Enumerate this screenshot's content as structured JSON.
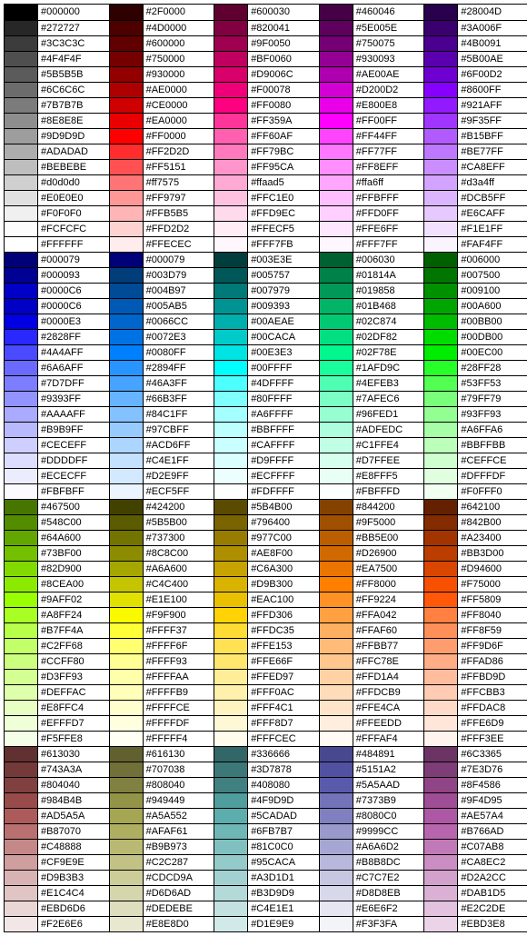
{
  "chart_data": {
    "type": "table",
    "title": "",
    "columns": 5,
    "rows": 53,
    "cells": [
      [
        "#000000",
        "#2F0000",
        "#600030",
        "#460046",
        "#28004D"
      ],
      [
        "#272727",
        "#4D0000",
        "#820041",
        "#5E005E",
        "#3A006F"
      ],
      [
        "#3C3C3C",
        "#600000",
        "#9F0050",
        "#750075",
        "#4B0091"
      ],
      [
        "#4F4F4F",
        "#750000",
        "#BF0060",
        "#930093",
        "#5B00AE"
      ],
      [
        "#5B5B5B",
        "#930000",
        "#D9006C",
        "#AE00AE",
        "#6F00D2"
      ],
      [
        "#6C6C6C",
        "#AE0000",
        "#F00078",
        "#D200D2",
        "#8600FF"
      ],
      [
        "#7B7B7B",
        "#CE0000",
        "#FF0080",
        "#E800E8",
        "#921AFF"
      ],
      [
        "#8E8E8E",
        "#EA0000",
        "#FF359A",
        "#FF00FF",
        "#9F35FF"
      ],
      [
        "#9D9D9D",
        "#FF0000",
        "#FF60AF",
        "#FF44FF",
        "#B15BFF"
      ],
      [
        "#ADADAD",
        "#FF2D2D",
        "#FF79BC",
        "#FF77FF",
        "#BE77FF"
      ],
      [
        "#BEBEBE",
        "#FF5151",
        "#FF95CA",
        "#FF8EFF",
        "#CA8EFF"
      ],
      [
        "#d0d0d0",
        "#ff7575",
        "#ffaad5",
        "#ffa6ff",
        "#d3a4ff"
      ],
      [
        "#E0E0E0",
        "#FF9797",
        "#FFC1E0",
        "#FFBFFF",
        "#DCB5FF"
      ],
      [
        "#F0F0F0",
        "#FFB5B5",
        "#FFD9EC",
        "#FFD0FF",
        "#E6CAFF"
      ],
      [
        "#FCFCFC",
        "#FFD2D2",
        "#FFECF5",
        "#FFE6FF",
        "#F1E1FF"
      ],
      [
        "#FFFFFF",
        "#FFECEC",
        "#FFF7FB",
        "#FFF7FF",
        "#FAF4FF"
      ],
      [
        "#000079",
        "#000079",
        "#003E3E",
        "#006030",
        "#006000"
      ],
      [
        "#000093",
        "#003D79",
        "#005757",
        "#01814A",
        "#007500"
      ],
      [
        "#0000C6",
        "#004B97",
        "#007979",
        "#019858",
        "#009100"
      ],
      [
        "#0000C6",
        "#005AB5",
        "#009393",
        "#01B468",
        "#00A600"
      ],
      [
        "#0000E3",
        "#0066CC",
        "#00AEAE",
        "#02C874",
        "#00BB00"
      ],
      [
        "#2828FF",
        "#0072E3",
        "#00CACA",
        "#02DF82",
        "#00DB00"
      ],
      [
        "#4A4AFF",
        "#0080FF",
        "#00E3E3",
        "#02F78E",
        "#00EC00"
      ],
      [
        "#6A6AFF",
        "#2894FF",
        "#00FFFF",
        "#1AFD9C",
        "#28FF28"
      ],
      [
        "#7D7DFF",
        "#46A3FF",
        "#4DFFFF",
        "#4EFEB3",
        "#53FF53"
      ],
      [
        "#9393FF",
        "#66B3FF",
        "#80FFFF",
        "#7AFEC6",
        "#79FF79"
      ],
      [
        "#AAAAFF",
        "#84C1FF",
        "#A6FFFF",
        "#96FED1",
        "#93FF93"
      ],
      [
        "#B9B9FF",
        "#97CBFF",
        "#BBFFFF",
        "#ADFEDC",
        "#A6FFA6"
      ],
      [
        "#CECEFF",
        "#ACD6FF",
        "#CAFFFF",
        "#C1FFE4",
        "#BBFFBB"
      ],
      [
        "#DDDDFF",
        "#C4E1FF",
        "#D9FFFF",
        "#D7FFEE",
        "#CEFFCE"
      ],
      [
        "#ECECFF",
        "#D2E9FF",
        "#ECFFFF",
        "#E8FFF5",
        "#DFFFDF"
      ],
      [
        "#FBFBFF",
        "#ECF5FF",
        "#FDFFFF",
        "#FBFFFD",
        "#F0FFF0"
      ],
      [
        "#467500",
        "#424200",
        "#5B4B00",
        "#844200",
        "#642100"
      ],
      [
        "#548C00",
        "#5B5B00",
        "#796400",
        "#9F5000",
        "#842B00"
      ],
      [
        "#64A600",
        "#737300",
        "#977C00",
        "#BB5E00",
        "#A23400"
      ],
      [
        "#73BF00",
        "#8C8C00",
        "#AE8F00",
        "#D26900",
        "#BB3D00"
      ],
      [
        "#82D900",
        "#A6A600",
        "#C6A300",
        "#EA7500",
        "#D94600"
      ],
      [
        "#8CEA00",
        "#C4C400",
        "#D9B300",
        "#FF8000",
        "#F75000"
      ],
      [
        "#9AFF02",
        "#E1E100",
        "#EAC100",
        "#FF9224",
        "#FF5809"
      ],
      [
        "#A8FF24",
        "#F9F900",
        "#FFD306",
        "#FFA042",
        "#FF8040"
      ],
      [
        "#B7FF4A",
        "#FFFF37",
        "#FFDC35",
        "#FFAF60",
        "#FF8F59"
      ],
      [
        "#C2FF68",
        "#FFFF6F",
        "#FFE153",
        "#FFBB77",
        "#FF9D6F"
      ],
      [
        "#CCFF80",
        "#FFFF93",
        "#FFE66F",
        "#FFC78E",
        "#FFAD86"
      ],
      [
        "#D3FF93",
        "#FFFFAA",
        "#FFED97",
        "#FFD1A4",
        "#FFBD9D"
      ],
      [
        "#DEFFAC",
        "#FFFFB9",
        "#FFF0AC",
        "#FFDCB9",
        "#FFCBB3"
      ],
      [
        "#E8FFC4",
        "#FFFFCE",
        "#FFF4C1",
        "#FFE4CA",
        "#FFDAC8"
      ],
      [
        "#EFFFD7",
        "#FFFFDF",
        "#FFF8D7",
        "#FFEEDD",
        "#FFE6D9"
      ],
      [
        "#F5FFE8",
        "#FFFFF4",
        "#FFFCEC",
        "#FFFAF4",
        "#FFF3EE"
      ],
      [
        "#613030",
        "#616130",
        "#336666",
        "#484891",
        "#6C3365"
      ],
      [
        "#743A3A",
        "#707038",
        "#3D7878",
        "#5151A2",
        "#7E3D76"
      ],
      [
        "#804040",
        "#808040",
        "#408080",
        "#5A5AAD",
        "#8F4586"
      ],
      [
        "#984B4B",
        "#949449",
        "#4F9D9D",
        "#7373B9",
        "#9F4D95"
      ],
      [
        "#AD5A5A",
        "#A5A552",
        "#5CADAD",
        "#8080C0",
        "#AE57A4"
      ],
      [
        "#B87070",
        "#AFAF61",
        "#6FB7B7",
        "#9999CC",
        "#B766AD"
      ],
      [
        "#C48888",
        "#B9B973",
        "#81C0C0",
        "#A6A6D2",
        "#C07AB8"
      ],
      [
        "#CF9E9E",
        "#C2C287",
        "#95CACA",
        "#B8B8DC",
        "#CA8EC2"
      ],
      [
        "#D9B3B3",
        "#CDCD9A",
        "#A3D1D1",
        "#C7C7E2",
        "#D2A2CC"
      ],
      [
        "#E1C4C4",
        "#D6D6AD",
        "#B3D9D9",
        "#D8D8EB",
        "#DAB1D5"
      ],
      [
        "#EBD6D6",
        "#DEDEBE",
        "#C4E1E1",
        "#E6E6F2",
        "#E2C2DE"
      ],
      [
        "#F2E6E6",
        "#E8E8D0",
        "#D1E9E9",
        "#F3F3FA",
        "#EBD3E8"
      ]
    ]
  }
}
